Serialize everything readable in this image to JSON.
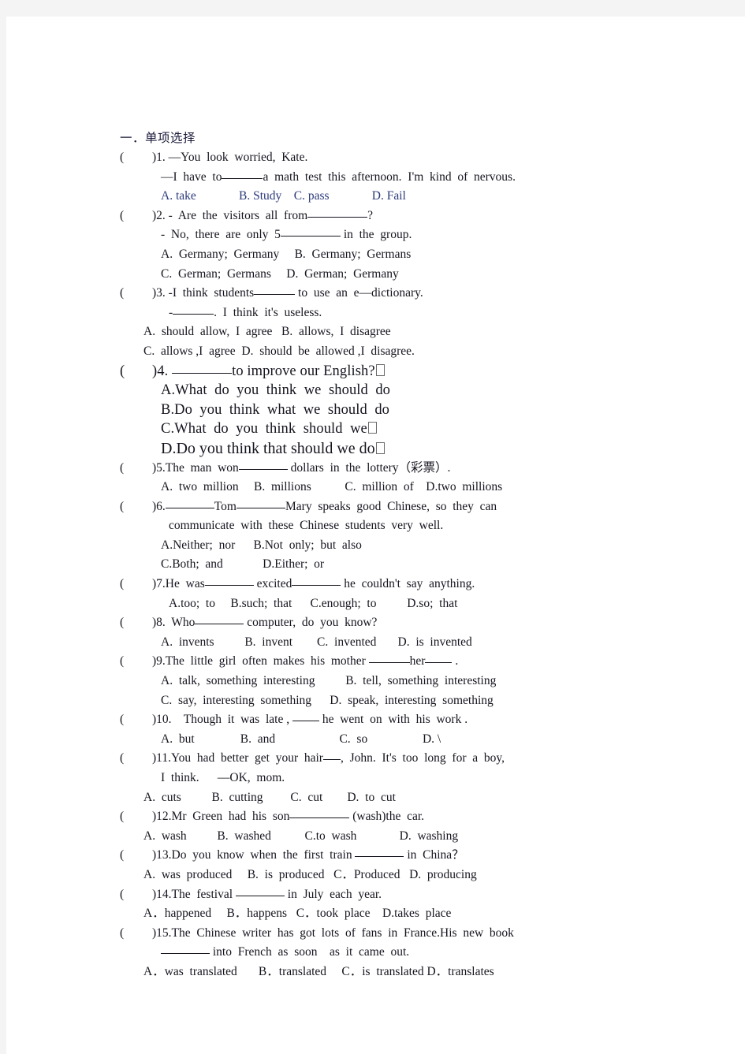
{
  "document": {
    "section_heading": "一．单项选择",
    "accent_color": "#2b3a7a",
    "text_color": "#15151f",
    "page_background": "#ffffff",
    "canvas_background": "#f4f4f4"
  },
  "questions": [
    {
      "number": "1",
      "marker_open": "(",
      "marker_close": ")",
      "stem_lines": [
        "1. —You  look  worried,  Kate.",
        "—I  have  to",
        "a  math  test  this  afternoon.  I'm  kind  of  nervous."
      ],
      "options_line": "A. take              B. Study    C. pass              D. Fail",
      "options_colored": true
    },
    {
      "number": "2",
      "stem_line_1_a": "2. -  Are  the  visitors  all  from",
      "stem_line_1_b": "?",
      "stem_line_2_a": "-  No,  there  are  only  5",
      "stem_line_2_b": "in  the  group.",
      "options_row_1": "A.  Germany;  Germany     B.  Germany;  Germans",
      "options_row_2": "C.  German;  Germans     D.  German;  Germany"
    },
    {
      "number": "3",
      "stem_line_1_a": "3. -I  think  students",
      "stem_line_1_b": "to  use  an  e—dictionary.",
      "stem_line_2_a": "-",
      "stem_line_2_b": ".  I  think  it's  useless.",
      "options_row_1": "A.  should  allow,  I  agree   B.  allows,  I  disagree",
      "options_row_2": "C.  allows ,I  agree  D.  should  be  allowed ,I  disagree."
    },
    {
      "number": "4",
      "stem_a": "4.",
      "stem_b": "to improve our English?",
      "option_a": "A.What  do  you  think  we  should  do",
      "option_b": "B.Do  you  think  what  we  should  do",
      "option_c": "C.What  do  you  think  should  we",
      "option_d": "D.Do you think that should we do"
    },
    {
      "number": "5",
      "stem_a": "5.The  man  won",
      "stem_b": "dollars  in  the  lottery（彩票）.",
      "options_line": "A.  two  million     B.  millions           C.  million  of    D.two  millions"
    },
    {
      "number": "6",
      "stem_a": "6.",
      "stem_b": "Tom",
      "stem_c": "Mary  speaks  good  Chinese,  so  they  can",
      "stem_line_2": "communicate  with  these  Chinese  students  very  well.",
      "options_row_1": "A.Neither;  nor      B.Not  only;  but  also",
      "options_row_2": "C.Both;  and             D.Either;  or"
    },
    {
      "number": "7",
      "stem_a": "7.He  was",
      "stem_b": "excited",
      "stem_c": "he  couldn't  say  anything.",
      "options_line": "A.too;  to     B.such;  that      C.enough;  to          D.so;  that"
    },
    {
      "number": "8",
      "stem_a": "8.  Who",
      "stem_b": "computer,  do  you  know?",
      "options_line": "A.  invents          B.  invent        C.  invented       D.  is  invented"
    },
    {
      "number": "9",
      "stem_a": "9.The  little  girl  often  makes  his  mother",
      "stem_b": "her",
      "stem_c": ".",
      "options_row_1": "A.  talk,  something  interesting          B.  tell,  something  interesting",
      "options_row_2": "C.  say,  interesting  something      D.  speak,  interesting  something"
    },
    {
      "number": "10",
      "stem_a": "10.    Though  it  was  late ,",
      "stem_b": "he  went  on  with  his  work .",
      "options_line": "A.  but               B.  and                     C.  so                  D. \\"
    },
    {
      "number": "11",
      "stem_line_1_a": "11.You  had  better  get  your  hair",
      "stem_line_1_b": ",  John.  It's  too  long  for  a  boy,",
      "stem_line_2": "I  think.      —OK,  mom.",
      "options_line": "A.  cuts          B.  cutting         C.  cut        D.  to  cut"
    },
    {
      "number": "12",
      "stem_a": "12.Mr  Green  had  his  son",
      "stem_b": "(wash)the  car.",
      "options_line": "A.  wash          B.  washed           C.to  wash              D.  washing"
    },
    {
      "number": "13",
      "stem_a": "13.Do  you  know  when  the  first  train",
      "stem_b": "in  China？",
      "options_line": "A.  was  produced     B.  is  produced   C．Produced   D.  producing"
    },
    {
      "number": "14",
      "stem_a": "14.The  festival",
      "stem_b": "in  July  each  year.",
      "options_line": "A．happened     B．happens   C．took  place    D.takes  place"
    },
    {
      "number": "15",
      "stem_line_1": "15.The  Chinese  writer  has  got  lots  of  fans  in  France.His  new  book",
      "stem_line_2_b": "into  French  as  soon    as  it  came  out.",
      "options_line": "A．was  translated       B．translated     C．is  translated D．translates"
    }
  ]
}
